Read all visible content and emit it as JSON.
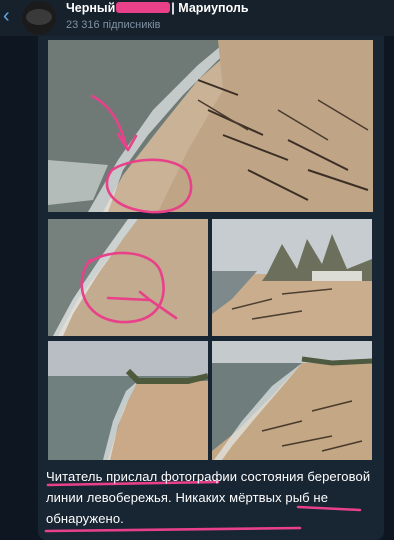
{
  "header": {
    "title_prefix": "Черный",
    "title_suffix": "| Мариуполь",
    "subscribers": "23 316 підписників"
  },
  "photos": [
    "beach-photo-1",
    "beach-photo-2",
    "beach-photo-3",
    "beach-photo-4",
    "beach-photo-5"
  ],
  "message": {
    "caption": "Читатель прислал фотографии состояния береговой линии левобережья. Никаких мёртвых рыб не обнаружено."
  },
  "colors": {
    "background": "#0e1621",
    "bubble": "#182533",
    "accent": "#5ea9e8",
    "annotation": "#e8418a"
  },
  "icons": [
    "back-arrow-icon"
  ]
}
